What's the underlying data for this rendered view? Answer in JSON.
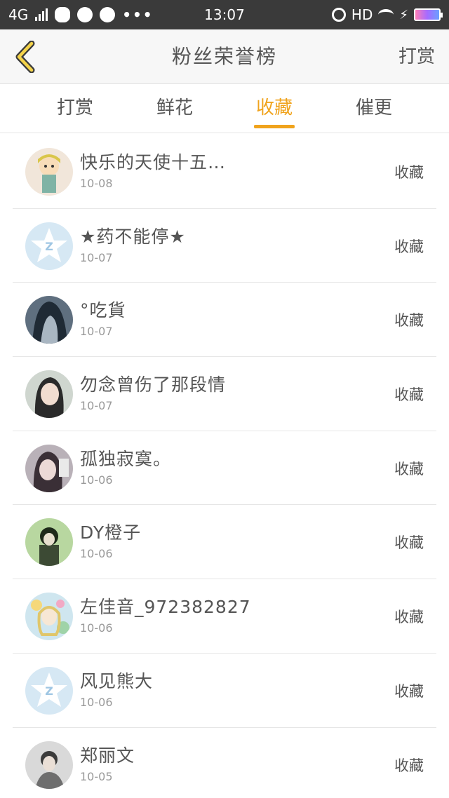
{
  "status_bar": {
    "network": "4G",
    "time": "13:07",
    "hd_label": "HD"
  },
  "header": {
    "title": "粉丝荣誉榜",
    "right_label": "打赏",
    "accent": "#f0a31c"
  },
  "tabs": [
    {
      "label": "打赏",
      "active": false
    },
    {
      "label": "鲜花",
      "active": false
    },
    {
      "label": "收藏",
      "active": true
    },
    {
      "label": "催更",
      "active": false
    }
  ],
  "list": [
    {
      "name": "快乐的天使十五…",
      "date": "10-08",
      "action": "收藏",
      "avatar": "cartoon-avatar"
    },
    {
      "name": "★药不能停★",
      "date": "10-07",
      "action": "收藏",
      "avatar": "default-star-avatar"
    },
    {
      "name": "°吃貨",
      "date": "10-07",
      "action": "收藏",
      "avatar": "dark-hair-avatar"
    },
    {
      "name": "勿念曾伤了那段情",
      "date": "10-07",
      "action": "收藏",
      "avatar": "girl-photo-avatar"
    },
    {
      "name": "孤独寂寞。",
      "date": "10-06",
      "action": "收藏",
      "avatar": "girl-photo-avatar"
    },
    {
      "name": "DY橙子",
      "date": "10-06",
      "action": "收藏",
      "avatar": "green-photo-avatar"
    },
    {
      "name": "左佳音_972382827",
      "date": "10-06",
      "action": "收藏",
      "avatar": "anime-avatar"
    },
    {
      "name": "风见熊大",
      "date": "10-06",
      "action": "收藏",
      "avatar": "default-star-avatar"
    },
    {
      "name": "郑丽文",
      "date": "10-05",
      "action": "收藏",
      "avatar": "photo-avatar"
    }
  ]
}
